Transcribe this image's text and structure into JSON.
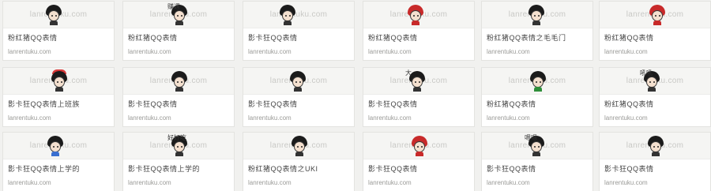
{
  "cards": [
    {
      "watermark": "lanrentuku.com",
      "title": "粉红猪QQ表情",
      "source": "lanrentuku.com",
      "tag": "",
      "face": "plain"
    },
    {
      "watermark": "lanrentuku.com",
      "title": "粉红猪QQ表情",
      "source": "lanrentuku.com",
      "tag": "赚週",
      "face": "plain"
    },
    {
      "watermark": "lanrentuku.com",
      "title": "影卡狂QQ表情",
      "source": "lanrentuku.com",
      "tag": "",
      "face": "plain"
    },
    {
      "watermark": "lanrentuku.com",
      "title": "粉红猪QQ表情",
      "source": "lanrentuku.com",
      "tag": "",
      "face": "red"
    },
    {
      "watermark": "lanrentuku.com",
      "title": "粉红猪QQ表情之毛毛门",
      "source": "lanrentuku.com",
      "tag": "",
      "face": "plain"
    },
    {
      "watermark": "lanrentuku.com",
      "title": "粉红猪QQ表情",
      "source": "lanrentuku.com",
      "tag": "",
      "face": "red"
    },
    {
      "watermark": "lanrentuku.com",
      "title": "影卡狂QQ表情上班族",
      "source": "lanrentuku.com",
      "tag": "",
      "face": "cap"
    },
    {
      "watermark": "lanrentuku.com",
      "title": "影卡狂QQ表情",
      "source": "lanrentuku.com",
      "tag": "",
      "face": "plain"
    },
    {
      "watermark": "lanrentuku.com",
      "title": "影卡狂QQ表情",
      "source": "lanrentuku.com",
      "tag": "",
      "face": "plain"
    },
    {
      "watermark": "lanrentuku.com",
      "title": "影卡狂QQ表情",
      "source": "lanrentuku.com",
      "tag": "大",
      "face": "plain"
    },
    {
      "watermark": "lanrentuku.com",
      "title": "粉红猪QQ表情",
      "source": "lanrentuku.com",
      "tag": "",
      "face": "green"
    },
    {
      "watermark": "lanrentuku.com",
      "title": "粉红猪QQ表情",
      "source": "lanrentuku.com",
      "tag": "吼吼",
      "face": "plain"
    },
    {
      "watermark": "lanrentuku.com",
      "title": "影卡狂QQ表情上学的",
      "source": "lanrentuku.com",
      "tag": "",
      "face": "blue"
    },
    {
      "watermark": "lanrentuku.com",
      "title": "影卡狂QQ表情上学的",
      "source": "lanrentuku.com",
      "tag": "好好吃",
      "face": "plain"
    },
    {
      "watermark": "lanrentuku.com",
      "title": "粉红猪QQ表情之UKI",
      "source": "lanrentuku.com",
      "tag": "",
      "face": "plain"
    },
    {
      "watermark": "lanrentuku.com",
      "title": "影卡狂QQ表情",
      "source": "lanrentuku.com",
      "tag": "",
      "face": "red"
    },
    {
      "watermark": "lanrentuku.com",
      "title": "影卡狂QQ表情",
      "source": "lanrentuku.com",
      "tag": "嗯嗯",
      "face": "plain"
    },
    {
      "watermark": "lanrentuku.com",
      "title": "影卡狂QQ表情",
      "source": "lanrentuku.com",
      "tag": "",
      "face": "plain"
    }
  ]
}
